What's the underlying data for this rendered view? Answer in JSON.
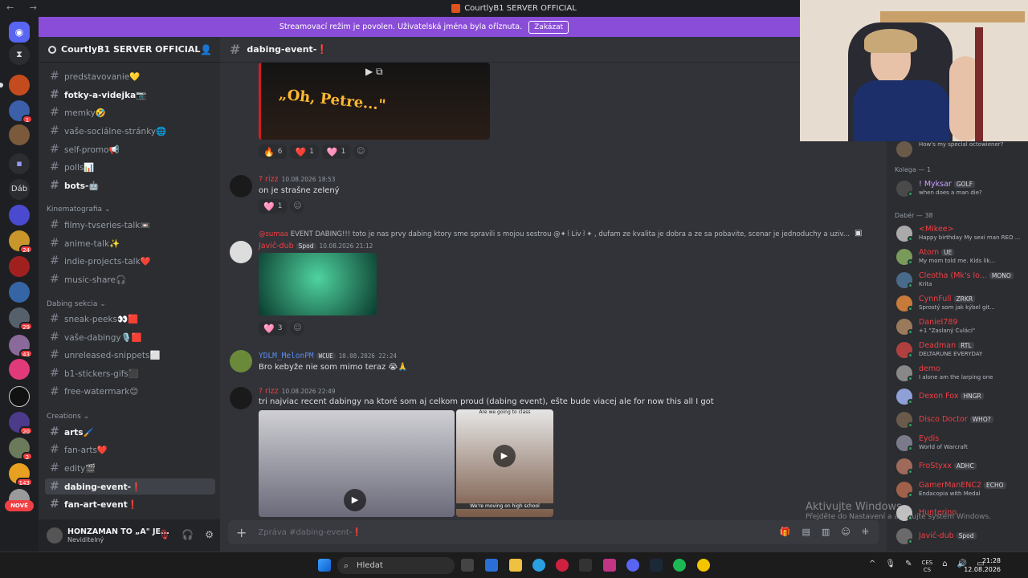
{
  "window": {
    "title": "CourtlyB1 SERVER OFFICIAL"
  },
  "banner": {
    "text": "Streamovací režim je povolen. Uživatelská jména byla oříznuta.",
    "button": "Zakázat"
  },
  "sidebar": {
    "server_name": "CourtlyB1 SERVER OFFICIAL",
    "channels": [
      {
        "name": "predstavovanie💛",
        "bold": false
      },
      {
        "name": "fotky-a-videjka📷",
        "bold": true
      },
      {
        "name": "memky🤣",
        "bold": false
      },
      {
        "name": "vaše-sociálne-stránky🌐",
        "bold": false
      },
      {
        "name": "self-promo📢",
        "bold": false
      },
      {
        "name": "polls📊",
        "bold": false
      },
      {
        "name": "bots-🤖",
        "bold": true
      }
    ],
    "categories": [
      "Kinematografia",
      "Dabing sekcia",
      "Creations"
    ],
    "kino_channels": [
      "filmy-tvseries-talk📼",
      "anime-talk✨",
      "indie-projects-talk❤️",
      "music-share🎧"
    ],
    "dabing_channels": [
      "sneak-peeks👀🟥",
      "vaše-dabingy🎙️🟥",
      "unreleased-snippets⬜",
      "b1-stickers-gifs⬛",
      "free-watermark😊"
    ],
    "creation_channels": [
      {
        "name": "arts🖌️",
        "bold": true
      },
      {
        "name": "fan-arts❤️",
        "bold": false
      },
      {
        "name": "edity🎬",
        "bold": false
      },
      {
        "name": "dabing-event-❗",
        "bold": true,
        "active": true
      },
      {
        "name": "fan-art-event❗",
        "bold": true
      }
    ],
    "user": {
      "name": "HONZAMAN TO „A\" JE...",
      "status": "Neviditelný"
    }
  },
  "guild_badges": [
    "1",
    "24",
    "29",
    "43",
    "20",
    "2",
    "143"
  ],
  "new_label": "NOVÉ",
  "chat": {
    "channel": "dabing-event-❗",
    "messages": [
      {
        "caption": "„Oh, Petre...\""
      },
      {
        "author": "? rizz",
        "time": "10.08.2026 18:53",
        "text": "on je strašne zelený"
      },
      {
        "reply_author": "@sumaa",
        "reply_text": "EVENT DABING!!!  toto je nas prvy dabing ktory sme spravili s mojou sestrou @✦꒰Liv꒱✦ , dufam ze kvalita je dobra a ze sa pobavite, scenar je jednoduchy a uziv...",
        "author": "Javič-dub",
        "tag": "Spod",
        "time": "10.08.2026 21:12"
      },
      {
        "author": "YDLM_MelonPM",
        "tag": "WCUE",
        "time": "10.08.2026 22:24",
        "text": "Bro kebyže nie som mimo teraz 😭🙏"
      },
      {
        "author": "? rizz",
        "time": "10.08.2026 22:49",
        "text": "tri najviac recent dabingy na ktoré som aj celkom proud (dabing event), ešte bude viacej ale for now this all I got"
      }
    ],
    "reactions_1": [
      {
        "e": "🔥",
        "n": "6"
      },
      {
        "e": "❤️",
        "n": "1"
      },
      {
        "e": "🩷",
        "n": "1"
      }
    ],
    "reactions_2": [
      {
        "e": "🩷",
        "n": "1"
      }
    ],
    "reactions_3": [
      {
        "e": "🩷",
        "n": "3"
      }
    ],
    "video_caption_top": "Are we going to class",
    "video_caption_bottom": "We're moving on high school",
    "composer_placeholder": "Zpráva #dabing-event-❗"
  },
  "members": {
    "top_activity": "How's my special octowiener?",
    "groups": [
      {
        "name": "Kolega — 1"
      },
      {
        "name": "Dabér — 38"
      }
    ],
    "list": [
      {
        "name": "! Myksar",
        "tag": "GOLF",
        "activity": "when does a man die?",
        "color": "#c9a0ff"
      },
      {
        "name": "<Mikee>",
        "activity": "Happy birthday My sexi man REO ...",
        "color": "#f23f43"
      },
      {
        "name": "Atom",
        "tag": "UE",
        "activity": "My mom told me. Kids lik...",
        "color": "#f23f43"
      },
      {
        "name": "Cleotha (Mk's lo...",
        "tag": "MONO",
        "activity": "Krita",
        "color": "#f23f43"
      },
      {
        "name": "CynnFull",
        "tag": "ZRKR",
        "activity": "Sprostý som jak kýbel git...",
        "color": "#f23f43"
      },
      {
        "name": "Daniel789",
        "activity": "+1 \"Zaslaný Čuláci\"",
        "color": "#f23f43"
      },
      {
        "name": "Deadman",
        "tag": "RTL",
        "activity": "DELTARUNE EVERYDAY",
        "color": "#f23f43"
      },
      {
        "name": "demo",
        "activity": "I alone am the larping one",
        "color": "#f23f43"
      },
      {
        "name": "Dexon Fox",
        "tag": "HNGR",
        "activity": "",
        "color": "#f23f43"
      },
      {
        "name": "Disco Doctor",
        "tag": "WHO?",
        "activity": "",
        "color": "#f23f43"
      },
      {
        "name": "Eydis",
        "activity": "World of Warcraft",
        "color": "#f23f43"
      },
      {
        "name": "FroStyxx",
        "tag": "ADHC",
        "activity": "",
        "color": "#f23f43"
      },
      {
        "name": "GamerManENC2",
        "tag": "ECHO",
        "activity": "Endacopia with Medal",
        "color": "#f23f43"
      },
      {
        "name": "Hunterino",
        "activity": "",
        "color": "#f23f43"
      },
      {
        "name": "Javič-dub",
        "tag": "Spod",
        "activity": "",
        "color": "#f23f43"
      }
    ]
  },
  "watermark": {
    "title": "Aktivujte Windows",
    "sub": "Přejděte do Nastavení a aktivujte systém Windows."
  },
  "taskbar": {
    "search": "Hledat",
    "lang": "CES",
    "lang2": "CS",
    "time": "21:28",
    "date": "12.08.2026"
  }
}
